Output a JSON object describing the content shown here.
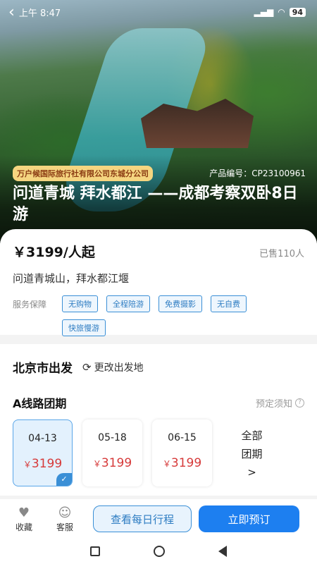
{
  "status_bar": {
    "time": "上午 8:47",
    "battery": "94"
  },
  "hero": {
    "agency": "万户候国际旅行社有限公司东城分公司",
    "product_code": "产品编号：CP23100961",
    "title": "问道青城 拜水都江 ——成都考察双卧8日游"
  },
  "info": {
    "price": "￥3199/人起",
    "sold": "已售110人",
    "subtitle": "问道青城山，拜水都江堰",
    "service_label": "服务保障",
    "service_tags": [
      "无购物",
      "全程陪游",
      "免费摄影",
      "无自费",
      "快旅慢游"
    ]
  },
  "departure": {
    "city": "北京市出发",
    "change_origin": "更改出发地",
    "route_title": "A线路团期",
    "booking_note": "预定须知",
    "dates": [
      {
        "date": "04-13",
        "price": "3199",
        "selected": true
      },
      {
        "date": "05-18",
        "price": "3199",
        "selected": false
      },
      {
        "date": "06-15",
        "price": "3199",
        "selected": false
      }
    ],
    "all_dates": [
      "全部",
      "团期",
      ">"
    ],
    "currency": "￥"
  },
  "bottom_bar": {
    "favorite": "收藏",
    "service": "客服",
    "itinerary": "查看每日行程",
    "book": "立即预订"
  },
  "colors": {
    "accent": "#1d7ff0",
    "price_red": "#d63a3a",
    "tag_yellow": "#f5d580"
  }
}
